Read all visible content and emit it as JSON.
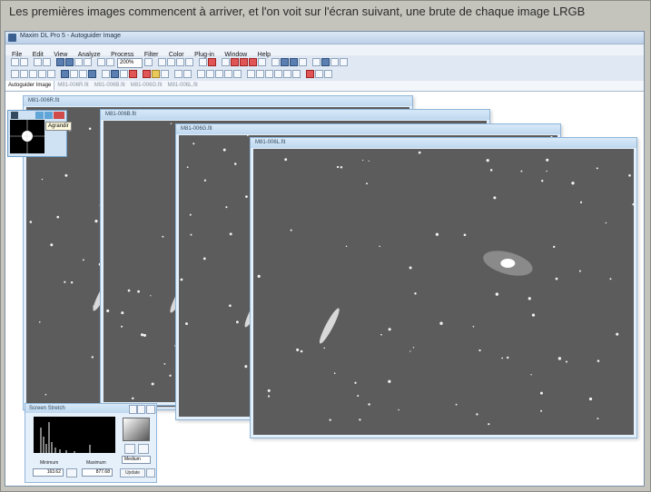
{
  "caption": "Les premières images commencent à arriver, et l'on voit sur l'écran suivant, une brute de chaque image LRGB",
  "app": {
    "title": "Maxim DL Pro 5 - Autoguider Image",
    "menu": [
      "File",
      "Edit",
      "View",
      "Analyze",
      "Process",
      "Filter",
      "Color",
      "Plug-in",
      "Window",
      "Help"
    ],
    "zoom": "200%"
  },
  "tabs": [
    "Autoguider Image",
    "M81-006R.fit",
    "M81-006B.fit",
    "M81-006G.fit",
    "M81-006L.fit"
  ],
  "windows": [
    {
      "title": "M81-006R.fit"
    },
    {
      "title": "M81-006B.fit"
    },
    {
      "title": "M81-006G.fit"
    },
    {
      "title": "M81-006L.fit"
    }
  ],
  "tooltip": "Agrandir",
  "stretch": {
    "title": "Screen Stretch",
    "min_label": "Minimum",
    "max_label": "Maximum",
    "min_value": "163.62",
    "max_value": "877.68",
    "mode": "Medium",
    "update": "Update"
  },
  "colors": {
    "accent": "#3b5f8f",
    "image_bg": "#5c5c5c"
  }
}
